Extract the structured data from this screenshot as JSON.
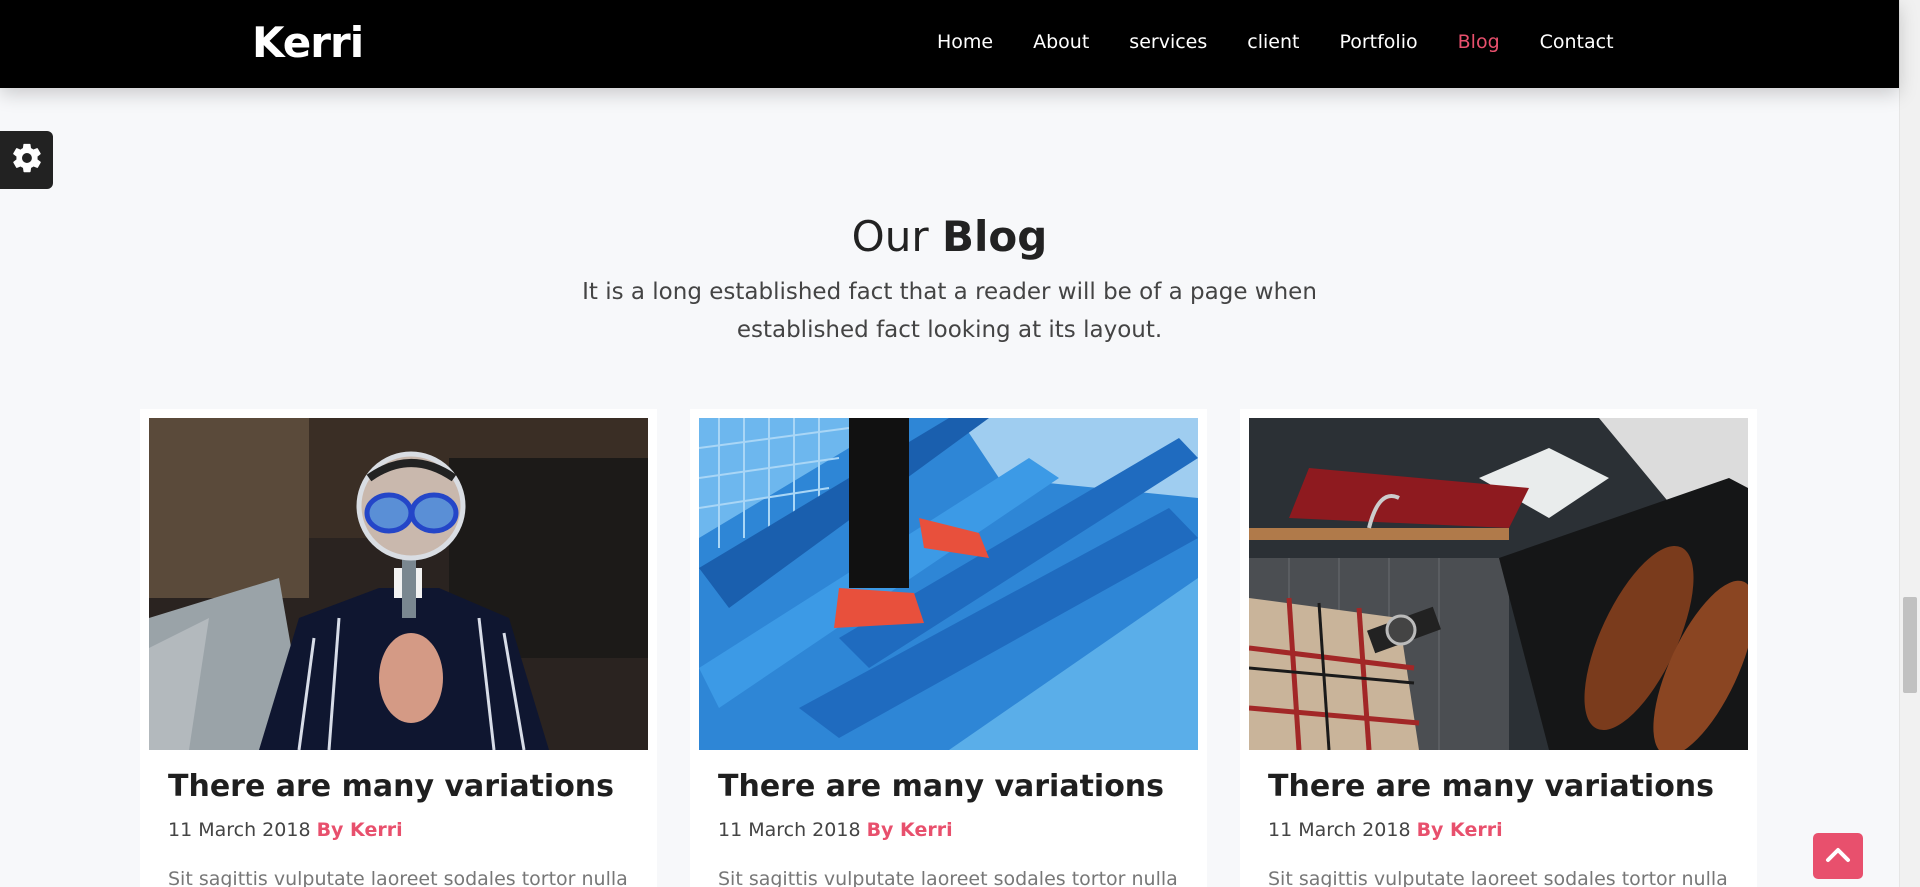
{
  "header": {
    "brand": "Kerri",
    "nav": [
      {
        "label": "Home",
        "active": false
      },
      {
        "label": "About",
        "active": false
      },
      {
        "label": "services",
        "active": false
      },
      {
        "label": "client",
        "active": false
      },
      {
        "label": "Portfolio",
        "active": false
      },
      {
        "label": "Blog",
        "active": true
      },
      {
        "label": "Contact",
        "active": false
      }
    ]
  },
  "section": {
    "title_light": "Our",
    "title_bold": "Blog",
    "subtitle_line1": "It is a long established fact that a reader will be of a page when",
    "subtitle_line2": "established fact looking at its layout."
  },
  "posts": [
    {
      "title": "There are many variations",
      "date": "11 March 2018",
      "author": "By Kerri",
      "excerpt": "Sit sagittis vulputate laoreet sodales tortor nulla",
      "image_icon": "magnifying-glass-person-image"
    },
    {
      "title": "There are many variations",
      "date": "11 March 2018",
      "author": "By Kerri",
      "excerpt": "Sit sagittis vulputate laoreet sodales tortor nulla",
      "image_icon": "blue-stairs-image"
    },
    {
      "title": "There are many variations",
      "date": "11 March 2018",
      "author": "By Kerri",
      "excerpt": "Sit sagittis vulputate laoreet sodales tortor nulla",
      "image_icon": "clothes-and-shoes-image"
    }
  ],
  "colors": {
    "accent": "#e8506d",
    "header_bg": "#000000",
    "page_bg": "#f7f8fa"
  },
  "icons": {
    "settings": "gear-icon",
    "scroll_top": "chevron-up-icon"
  }
}
